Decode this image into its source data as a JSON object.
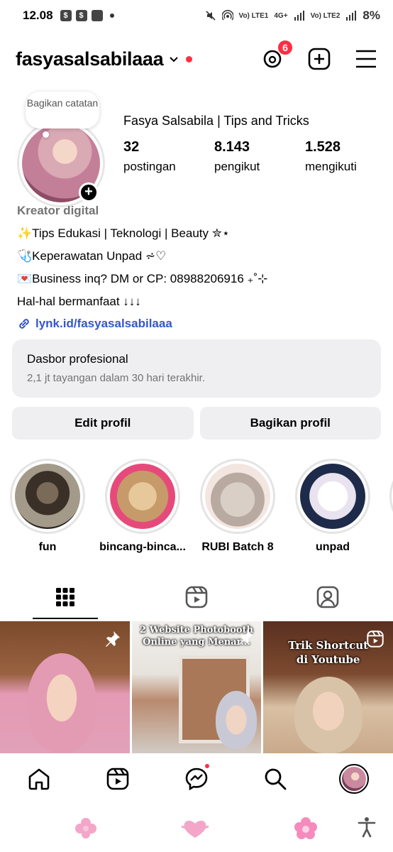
{
  "status_bar": {
    "time": "12.08",
    "network_1": "Vo) LTE1",
    "network_2": "Vo) LTE2",
    "network_type": "4G+",
    "battery": "8%"
  },
  "header": {
    "username": "fasyasalsabilaaa",
    "threads_badge": "6"
  },
  "profile": {
    "note": "Bagikan catatan",
    "display_name": "Fasya Salsabila | Tips and Tricks",
    "stats": [
      {
        "value": "32",
        "label": "postingan"
      },
      {
        "value": "8.143",
        "label": "pengikut"
      },
      {
        "value": "1.528",
        "label": "mengikuti"
      }
    ],
    "category": "Kreator digital",
    "bio_lines": [
      "✨Tips Edukasi | Teknologi | Beauty ✮⋆",
      "🩺Keperawatan Unpad ⩫♡",
      "💌Business inq? DM or CP: 08988206916 ₊˚⊹",
      "Hal-hal bermanfaat ↓↓↓"
    ],
    "link": "lynk.id/fasyasalsabilaaa"
  },
  "dashboard": {
    "title": "Dasbor profesional",
    "subtitle": "2,1 jt tayangan dalam 30 hari terakhir."
  },
  "buttons": {
    "edit": "Edit profil",
    "share": "Bagikan profil"
  },
  "highlights": [
    {
      "label": "fun"
    },
    {
      "label": "bincang-binca..."
    },
    {
      "label": "RUBI Batch 8"
    },
    {
      "label": "unpad"
    }
  ],
  "posts": [
    {
      "caption": ""
    },
    {
      "caption_1": "2 Website Photobooth",
      "caption_2": "Online yang Menar..."
    },
    {
      "caption_1": "Trik Shortcut",
      "caption_2": "di Youtube"
    }
  ],
  "colors": {
    "accent_red": "#ff2d44",
    "link_blue": "#3457c9",
    "muted_gray": "#737373",
    "button_bg": "#efeff1"
  }
}
